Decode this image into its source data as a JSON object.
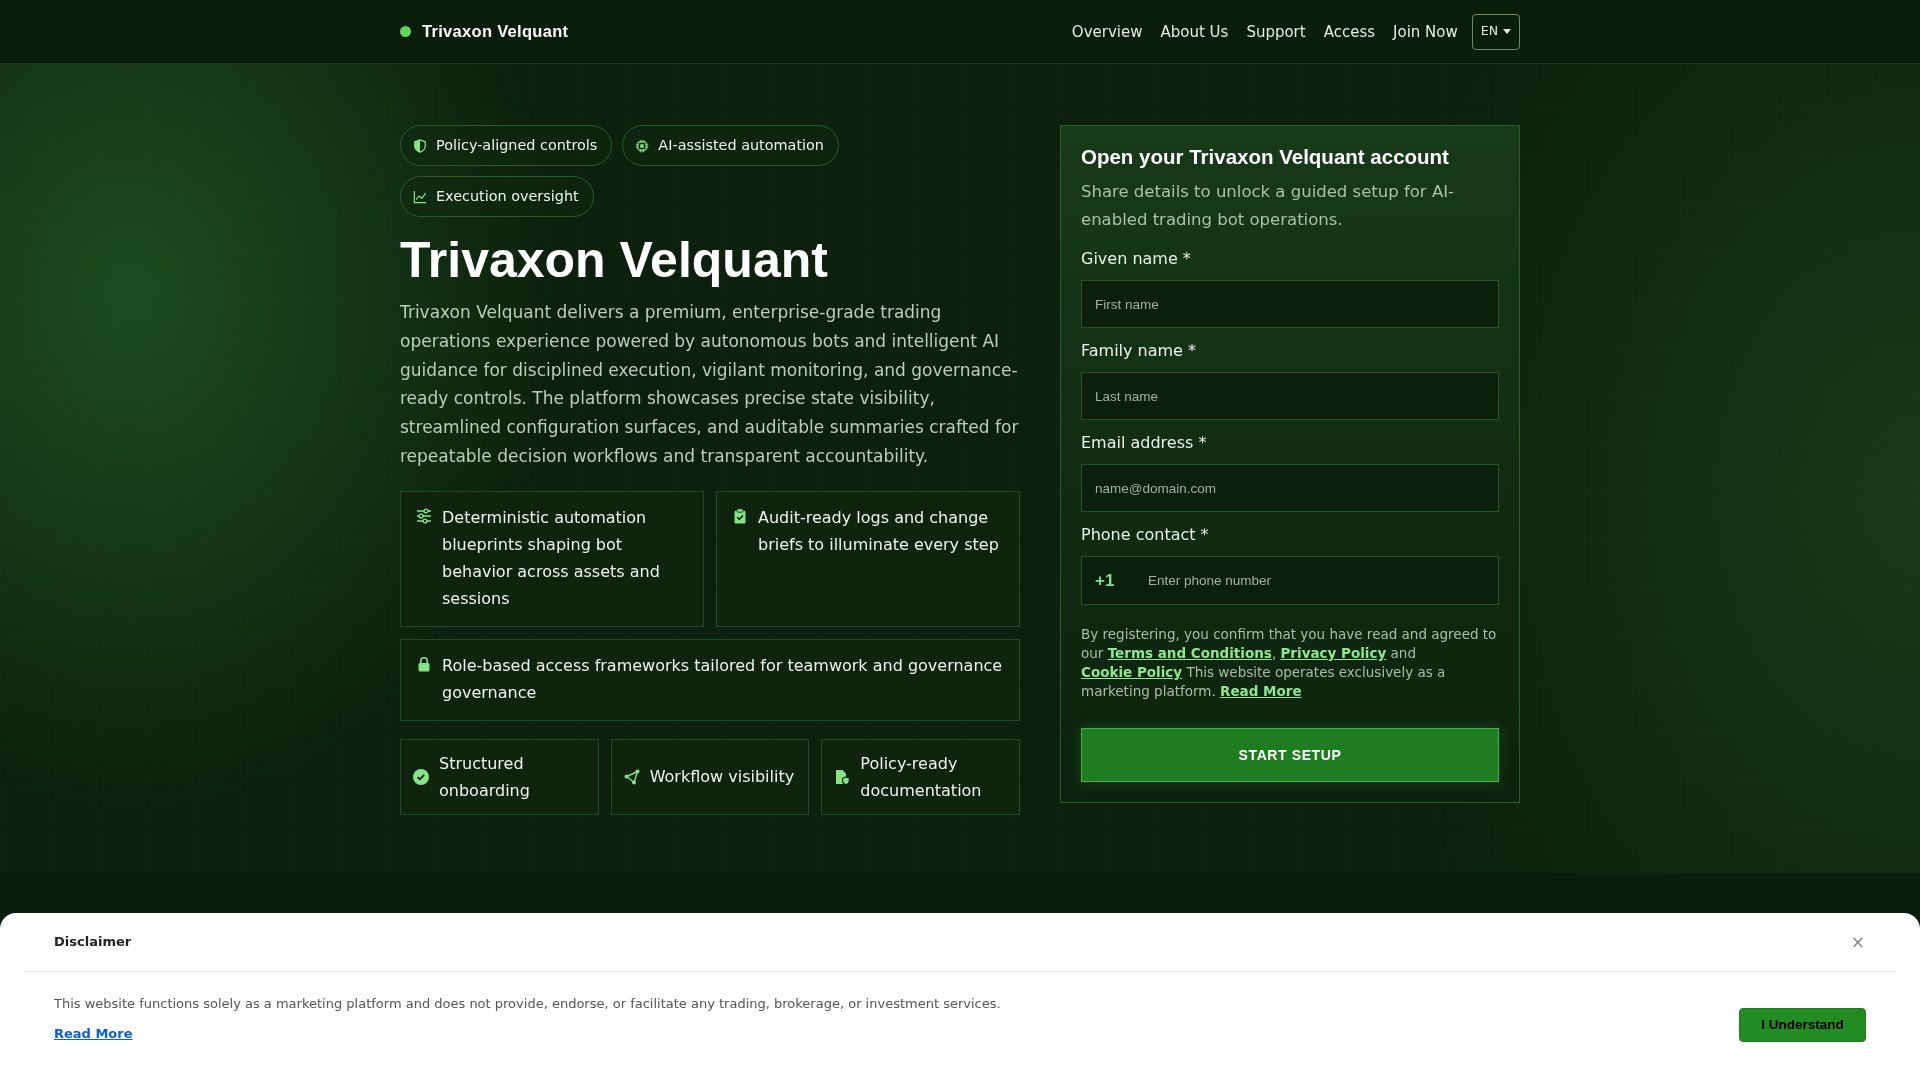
{
  "navbar": {
    "brand": "Trivaxon Velquant",
    "links": [
      "Overview",
      "About Us",
      "Support",
      "Access",
      "Join Now"
    ],
    "language": "EN"
  },
  "hero": {
    "badges": [
      "Policy-aligned controls",
      "AI-assisted automation",
      "Execution oversight"
    ],
    "title": "Trivaxon Velquant",
    "description": "Trivaxon Velquant delivers a premium, enterprise-grade trading operations experience powered by autonomous bots and intelligent AI guidance for disciplined execution, vigilant monitoring, and governance-ready controls. The platform showcases precise state visibility, streamlined configuration surfaces, and auditable summaries crafted for repeatable decision workflows and transparent accountability.",
    "feature_cards": [
      "Deterministic automation blueprints shaping bot behavior across assets and sessions",
      "Audit-ready logs and change briefs to illuminate every step",
      "Role-based access frameworks tailored for teamwork and governance governance"
    ],
    "highlights": [
      "Structured onboarding",
      "Workflow visibility",
      "Policy-ready documentation"
    ]
  },
  "signup_form": {
    "title": "Open your Trivaxon Velquant account",
    "subtitle": "Share details to unlock a guided setup for AI-enabled trading bot operations.",
    "fields": [
      {
        "kind": "text",
        "label": "Given name *",
        "placeholder": "First name"
      },
      {
        "kind": "text",
        "label": "Family name *",
        "placeholder": "Last name"
      },
      {
        "kind": "email",
        "label": "Email address *",
        "placeholder": "name@domain.com"
      },
      {
        "kind": "phone",
        "label": "Phone contact *",
        "prefix": "+1",
        "placeholder": "Enter phone number"
      }
    ],
    "consent": [
      {
        "kind": "text",
        "text": "By registering, you confirm that you have read and agreed to our "
      },
      {
        "kind": "link",
        "text": "Terms and Conditions"
      },
      {
        "kind": "text",
        "text": ", "
      },
      {
        "kind": "link",
        "text": "Privacy Policy"
      },
      {
        "kind": "text",
        "text": " and "
      },
      {
        "kind": "link",
        "text": "Cookie Policy"
      },
      {
        "kind": "text",
        "text": " This website operates exclusively as a marketing platform. "
      },
      {
        "kind": "link",
        "text": "Read More"
      }
    ],
    "submit": "START SETUP"
  },
  "disclaimer": {
    "title": "Disclaimer",
    "close": "×",
    "text": "This website functions solely as a marketing platform and does not provide, endorse, or facilitate any trading, brokerage, or investment services.",
    "link": "Read More",
    "button": "I Understand"
  }
}
